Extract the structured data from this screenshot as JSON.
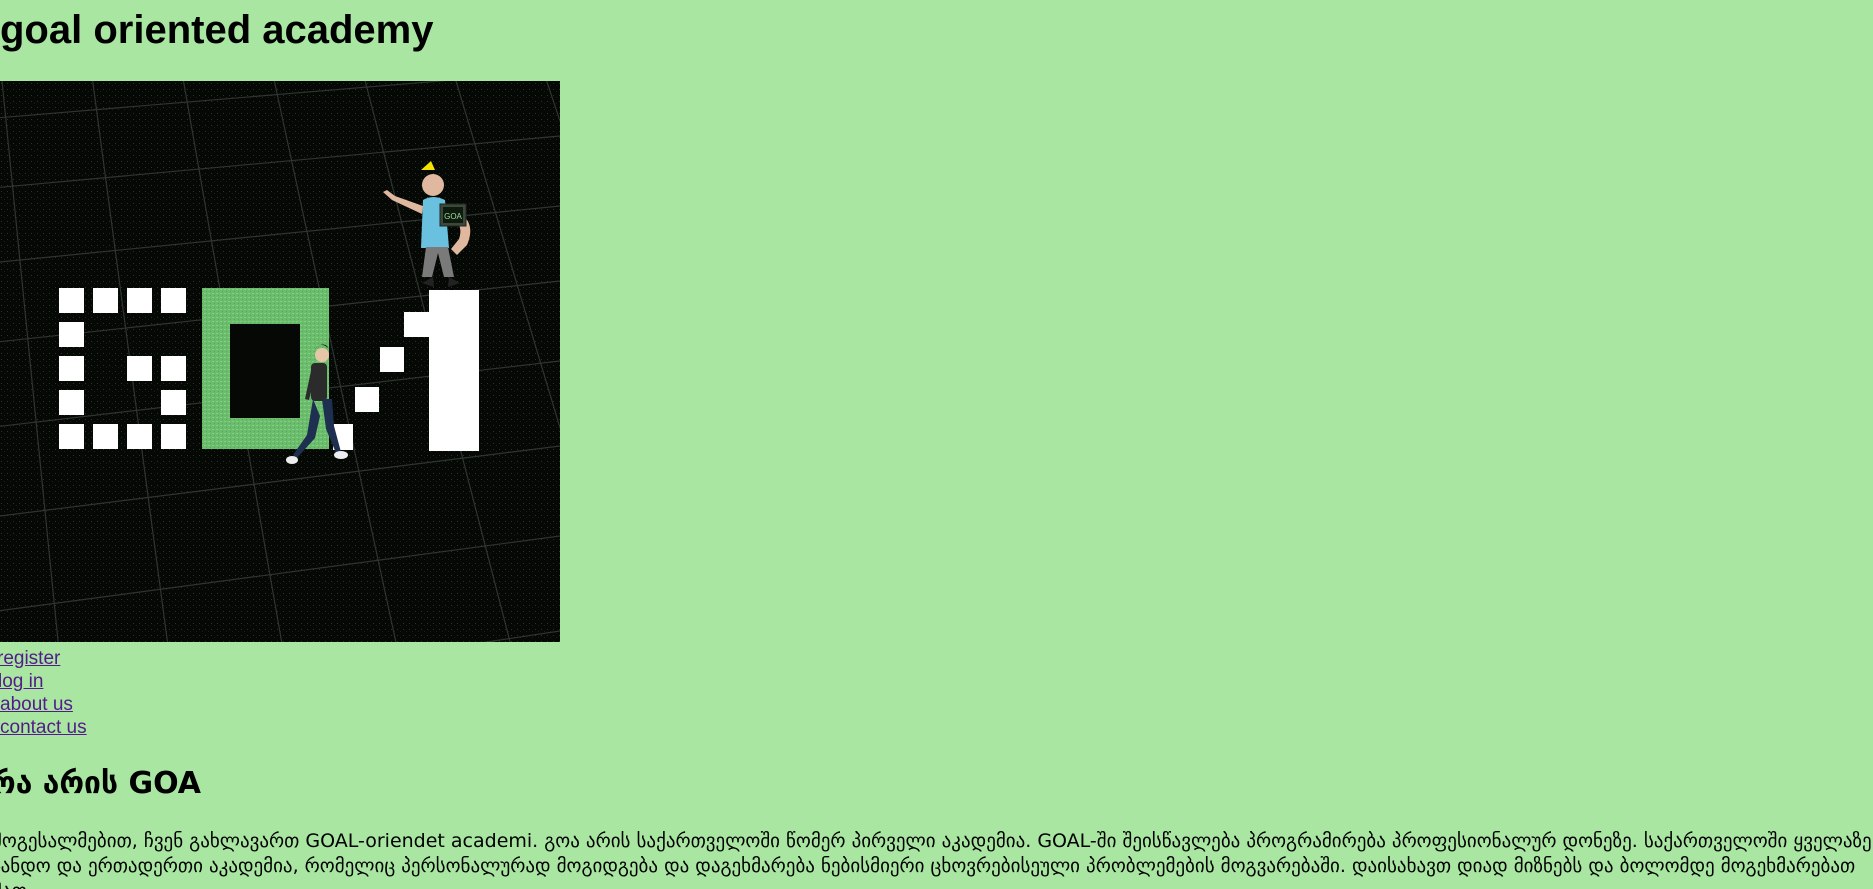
{
  "site": {
    "title": "goal oriented academy"
  },
  "hero": {
    "logo_text": "GOA",
    "laptop_sticker": "GOA"
  },
  "nav": {
    "links": [
      "register",
      "log in",
      "about us",
      "contact us"
    ]
  },
  "section": {
    "title": "რა არის GOA",
    "paragraph": "მოგესალმებით, ჩვენ გახლავართ GOAL-oriendet academi. გოა არის საქართველოში წომერ პირველი აკადემია. GOAL-ში შეისწავლება პროგრამირება პროფესიონალურ დონეზე. საქართველოში ყველაზე ჯანდო და ერთადერთი აკადემია, რომელიც პერსონალურად მოგიდგება და დაგეხმარება ნებისმიერი ცხოვრებისეული პრობლემების მოგვარებაში. დაისახავთ დიად მიზნებს და ბოლომდე მოგეხმარებათ მათ"
  },
  "colors": {
    "background": "#a8e6a1",
    "link": "#551a8b",
    "hero_background": "#050805",
    "logo_white": "#ffffff",
    "logo_green": "#6bbd6d"
  }
}
